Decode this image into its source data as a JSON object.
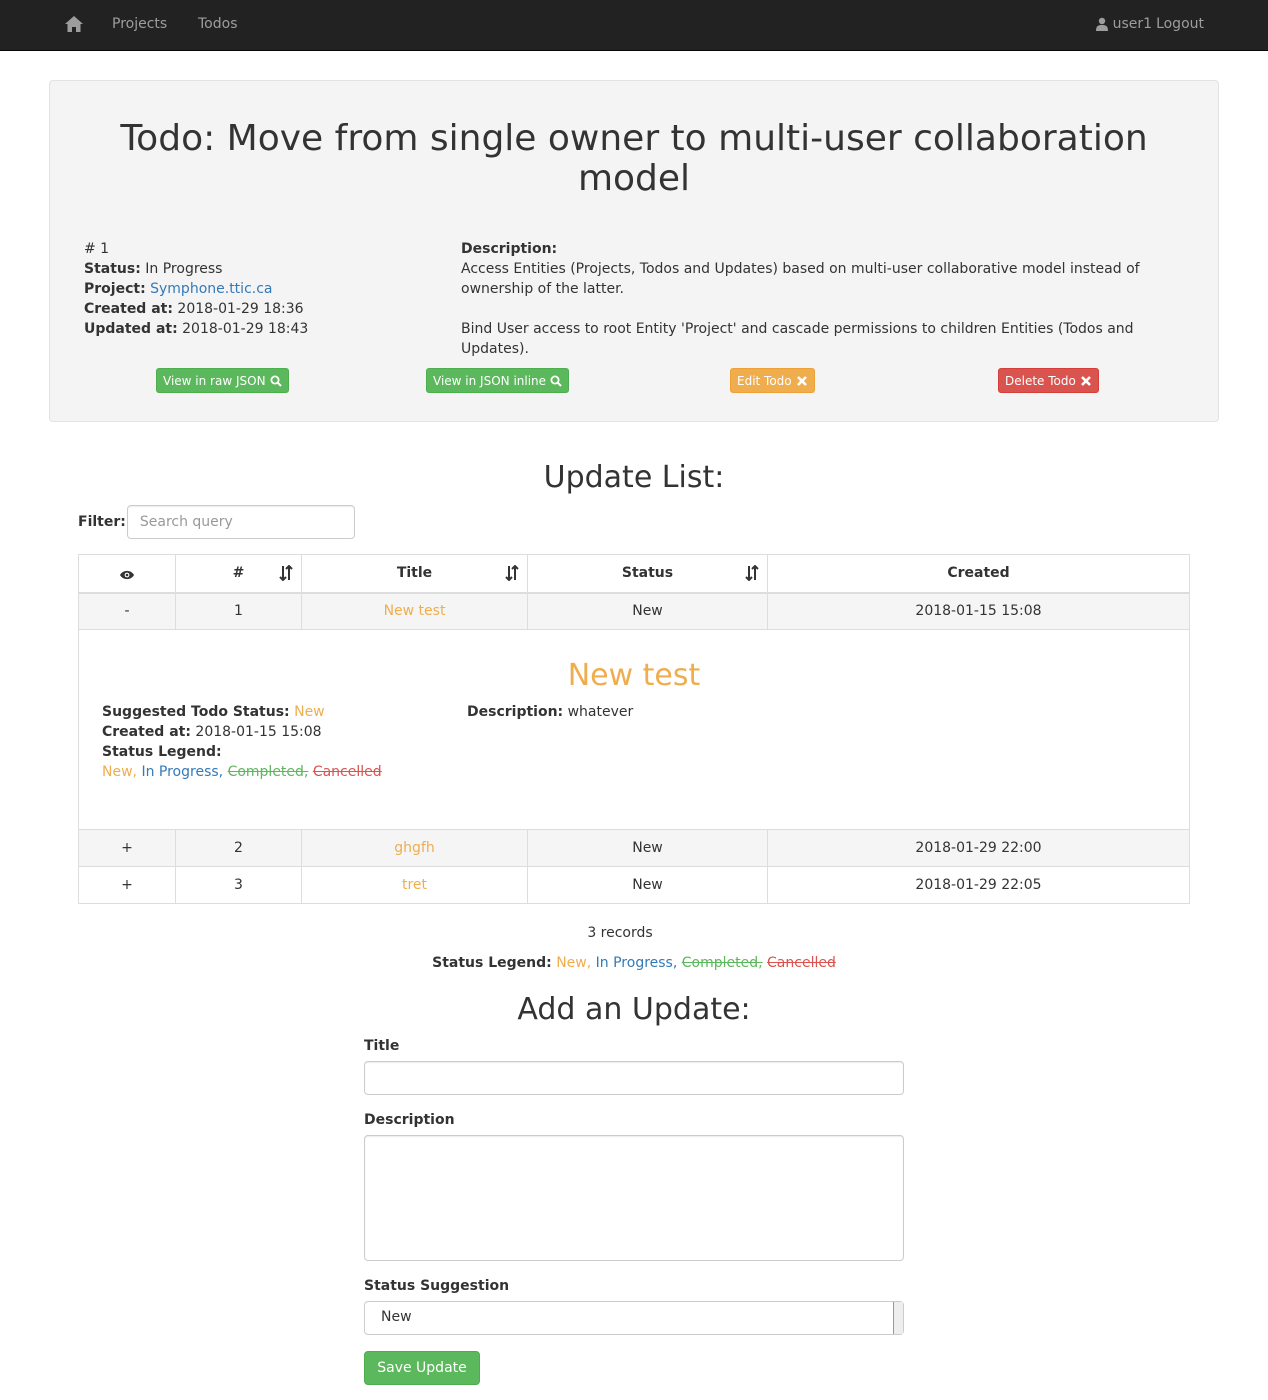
{
  "nav": {
    "projects": "Projects",
    "todos": "Todos",
    "user": "user1",
    "logout": "Logout"
  },
  "todo": {
    "title": "Todo: Move from single owner to multi-user collaboration model",
    "id_label": "# 1",
    "status_label": "Status:",
    "status": "In Progress",
    "project_label": "Project:",
    "project": "Symphone.ttic.ca",
    "created_label": "Created at:",
    "created": "2018-01-29 18:36",
    "updated_label": "Updated at:",
    "updated": "2018-01-29 18:43",
    "description_label": "Description:",
    "description_p1": "Access Entities (Projects, Todos and Updates) based on multi-user collaborative model instead of ownership of the latter.",
    "description_p2": "Bind User access to root Entity 'Project' and cascade permissions to children Entities (Todos and Updates)."
  },
  "buttons": {
    "raw_json": "View in raw JSON",
    "json_inline": "View in JSON inline",
    "edit": "Edit Todo",
    "delete": "Delete Todo"
  },
  "updates": {
    "heading": "Update List:",
    "filter_label": "Filter:",
    "filter_placeholder": "Search query",
    "columns": [
      "#",
      "Title",
      "Status",
      "Created"
    ],
    "rows": [
      {
        "toggle": "-",
        "num": "1",
        "title": "New test",
        "status": "New",
        "created": "2018-01-15 15:08"
      },
      {
        "toggle": "+",
        "num": "2",
        "title": "ghgfh",
        "status": "New",
        "created": "2018-01-29 22:00"
      },
      {
        "toggle": "+",
        "num": "3",
        "title": "tret",
        "status": "New",
        "created": "2018-01-29 22:05"
      }
    ],
    "detail": {
      "title": "New test",
      "suggested_label": "Suggested Todo Status:",
      "suggested": "New",
      "created_label": "Created at:",
      "created": "2018-01-15 15:08",
      "legend_label": "Status Legend:",
      "description_label": "Description:",
      "description": "whatever"
    },
    "records": "3 records"
  },
  "legend": {
    "label": "Status Legend:",
    "new": "New,",
    "in_progress": "In Progress,",
    "completed": "Completed,",
    "cancelled": "Cancelled"
  },
  "form": {
    "heading": "Add an Update:",
    "title_label": "Title",
    "title_value": "",
    "description_label": "Description",
    "description_value": "",
    "status_label": "Status Suggestion",
    "status_value": "New",
    "save": "Save Update"
  },
  "colors": {
    "new": "#f0ad4e",
    "in_progress": "#337ab7",
    "completed": "#5cb85c",
    "cancelled": "#d9534f"
  }
}
